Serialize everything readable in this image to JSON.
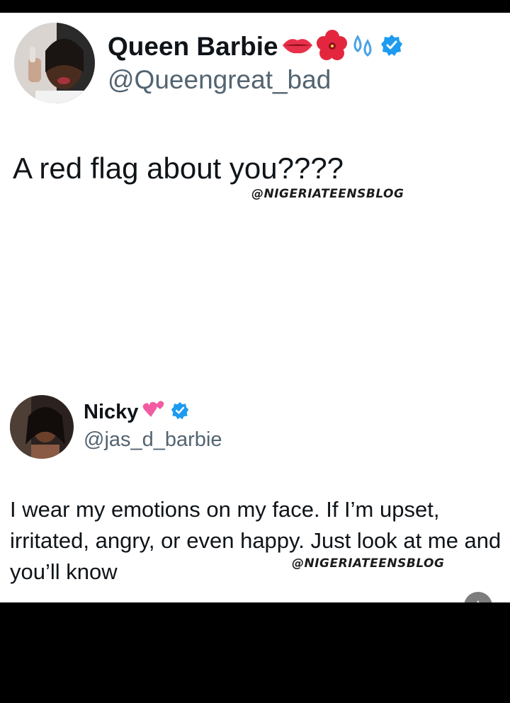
{
  "tweets": [
    {
      "display_name": "Queen Barbie",
      "handle": "@Queengreat_bad",
      "text": "A red flag about you????",
      "watermark": "@NIGERIATEENSBLOG",
      "emojis": [
        "lips-icon",
        "hibiscus-icon",
        "sweat-droplets-icon"
      ],
      "verified": true
    },
    {
      "display_name": "Nicky",
      "handle": "@jas_d_barbie",
      "text": "I wear my emotions on my face. If I’m upset, irritated, angry, or even happy. Just look at me and you’ll know",
      "watermark": "@NIGERIATEENSBLOG",
      "emojis": [
        "heart-with-ribbon-icon"
      ],
      "verified": true
    }
  ],
  "colors": {
    "verified_blue": "#1d9bf0",
    "text_primary": "#0f1419",
    "text_secondary": "#536471"
  }
}
